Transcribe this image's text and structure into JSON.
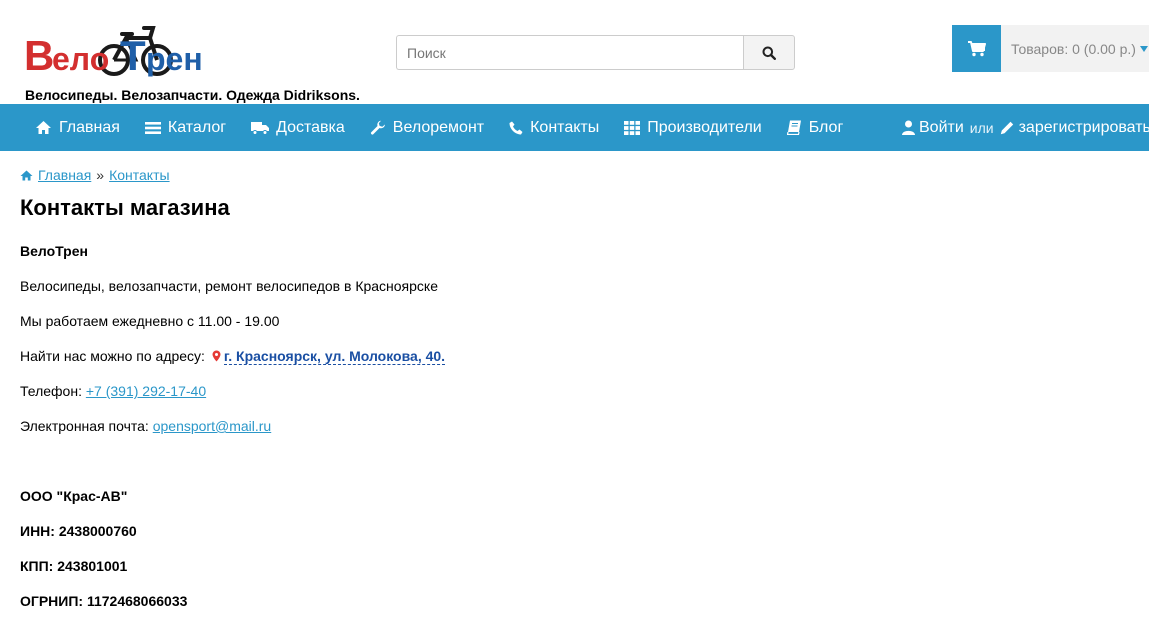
{
  "header": {
    "logo_text": "ВелоТрен",
    "tagline": "Велосипеды. Велозапчасти. Одежда Didriksons.",
    "search": {
      "placeholder": "Поиск",
      "value": "",
      "button_icon": "search-icon"
    },
    "cart": {
      "label": "Товаров: 0 (0.00 р.)",
      "icon": "cart-icon"
    }
  },
  "nav": {
    "items": [
      {
        "label": "Главная",
        "icon": "home-icon"
      },
      {
        "label": "Каталог",
        "icon": "list-icon"
      },
      {
        "label": "Доставка",
        "icon": "truck-icon"
      },
      {
        "label": "Велоремонт",
        "icon": "wrench-icon"
      },
      {
        "label": "Контакты",
        "icon": "phone-icon"
      },
      {
        "label": "Производители",
        "icon": "grid-icon"
      },
      {
        "label": "Блог",
        "icon": "book-icon"
      }
    ],
    "login": "Войти",
    "or": "или",
    "register": "зарегистрироваться"
  },
  "breadcrumb": {
    "home": "Главная",
    "separator": "»",
    "current": "Контакты"
  },
  "page": {
    "title": "Контакты магазина",
    "store_name": "ВелоТрен",
    "description": "Велосипеды, велозапчасти, ремонт велосипедов в Красноярске",
    "hours": "Мы работаем ежедневно с 11.00 - 19.00",
    "address_label": "Найти нас можно по адресу:",
    "address": "г. Красноярск, ул. Молокова, 40.",
    "phone_label": "Телефон:",
    "phone": "+7 (391) 292-17-40",
    "email_label": "Электронная почта:",
    "email": "opensport@mail.ru",
    "company": "ООО \"Крас-АВ\"",
    "inn": "ИНН: 2438000760",
    "kpp": "КПП: 243801001",
    "ogrnip": "ОГРНИП: 1172468066033"
  },
  "colors": {
    "accent": "#2b97c9",
    "logo_red": "#d32f2f",
    "logo_blue": "#1f5fa8",
    "address_link": "#1a4fa3"
  }
}
